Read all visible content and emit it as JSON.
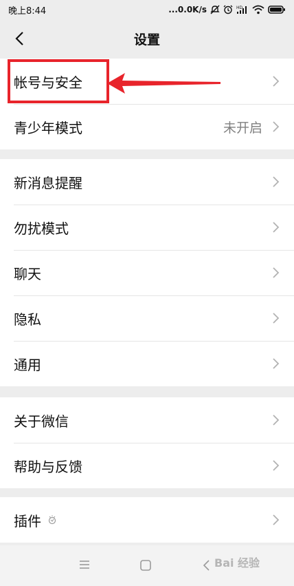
{
  "status_bar": {
    "time": "晚上8:44",
    "net_speed": "...0.0K/s",
    "icons": [
      "mute-icon",
      "alarm-icon",
      "signal-hd-icon",
      "wifi-icon",
      "battery-icon"
    ]
  },
  "nav": {
    "title": "设置",
    "back_icon": "chevron-left-icon"
  },
  "groups": [
    {
      "items": [
        {
          "label": "帐号与安全",
          "value": ""
        },
        {
          "label": "青少年模式",
          "value": "未开启"
        }
      ]
    },
    {
      "items": [
        {
          "label": "新消息提醒",
          "value": ""
        },
        {
          "label": "勿扰模式",
          "value": ""
        },
        {
          "label": "聊天",
          "value": ""
        },
        {
          "label": "隐私",
          "value": ""
        },
        {
          "label": "通用",
          "value": ""
        }
      ]
    },
    {
      "items": [
        {
          "label": "关于微信",
          "value": ""
        },
        {
          "label": "帮助与反馈",
          "value": ""
        }
      ]
    },
    {
      "items": [
        {
          "label": "插件",
          "value": "",
          "badge_icon": "plugin-icon"
        }
      ]
    }
  ],
  "annotation": {
    "color": "#e8242b",
    "target": "帐号与安全"
  },
  "bottom_nav": {
    "icons": [
      "menu-icon",
      "home-icon",
      "back-icon"
    ]
  },
  "watermark": "Bai 经验"
}
